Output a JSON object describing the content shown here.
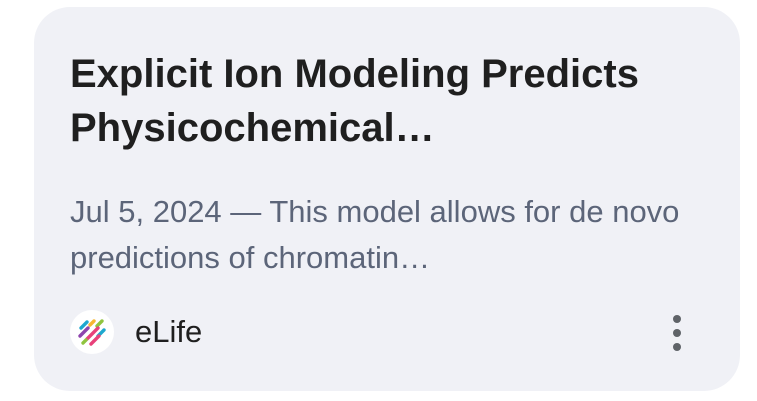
{
  "result": {
    "title": "Explicit Ion Modeling Predicts Physicochemical…",
    "snippet": "Jul 5, 2024 — This model allows for de novo predictions of chromatin…",
    "source": {
      "name": "eLife",
      "icon": "elife-logo-icon",
      "logo_colors": [
        "#e8417a",
        "#1ea8cf",
        "#8fc43f",
        "#f7b731",
        "#8e44ad"
      ]
    },
    "menu_icon": "more-vert-icon"
  }
}
